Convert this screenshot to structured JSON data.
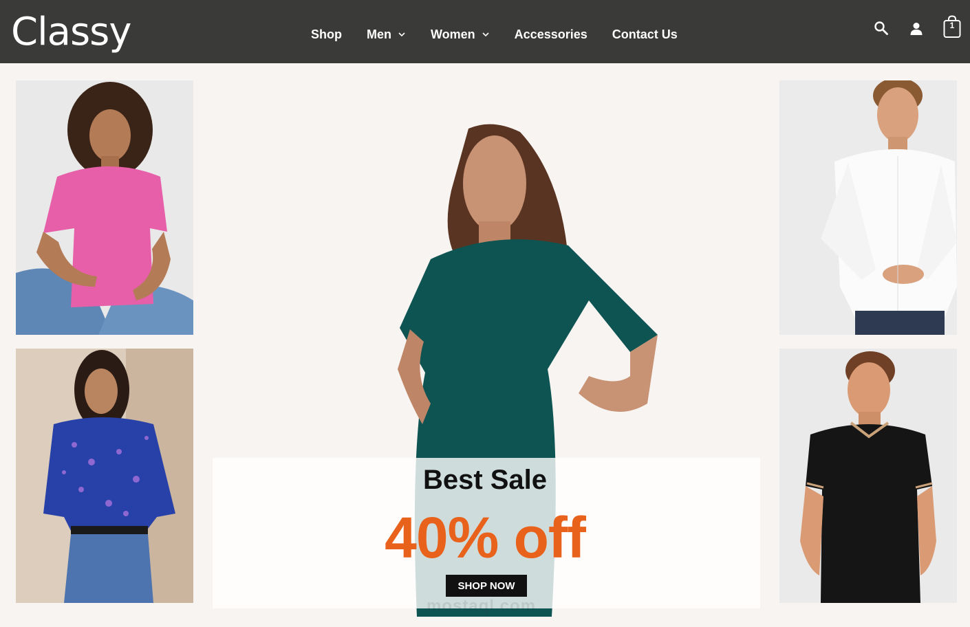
{
  "header": {
    "logo": "Classy",
    "cart_count": "1"
  },
  "nav": {
    "items": [
      {
        "label": "Shop",
        "has_dropdown": false
      },
      {
        "label": "Men",
        "has_dropdown": true
      },
      {
        "label": "Women",
        "has_dropdown": true
      },
      {
        "label": "Accessories",
        "has_dropdown": false
      },
      {
        "label": "Contact Us",
        "has_dropdown": false
      }
    ]
  },
  "icons": {
    "search": "search-icon",
    "account": "user-icon",
    "cart": "shopping-bag-icon",
    "dropdown": "chevron-down-icon"
  },
  "promo": {
    "title": "Best Sale",
    "discount": "40% off",
    "button": "SHOP NOW"
  },
  "watermark": "mostaql.com",
  "colors": {
    "header_bg": "#3a3a38",
    "page_bg": "#f7f4f1",
    "accent": "#e8621c",
    "button_bg": "#111111"
  }
}
